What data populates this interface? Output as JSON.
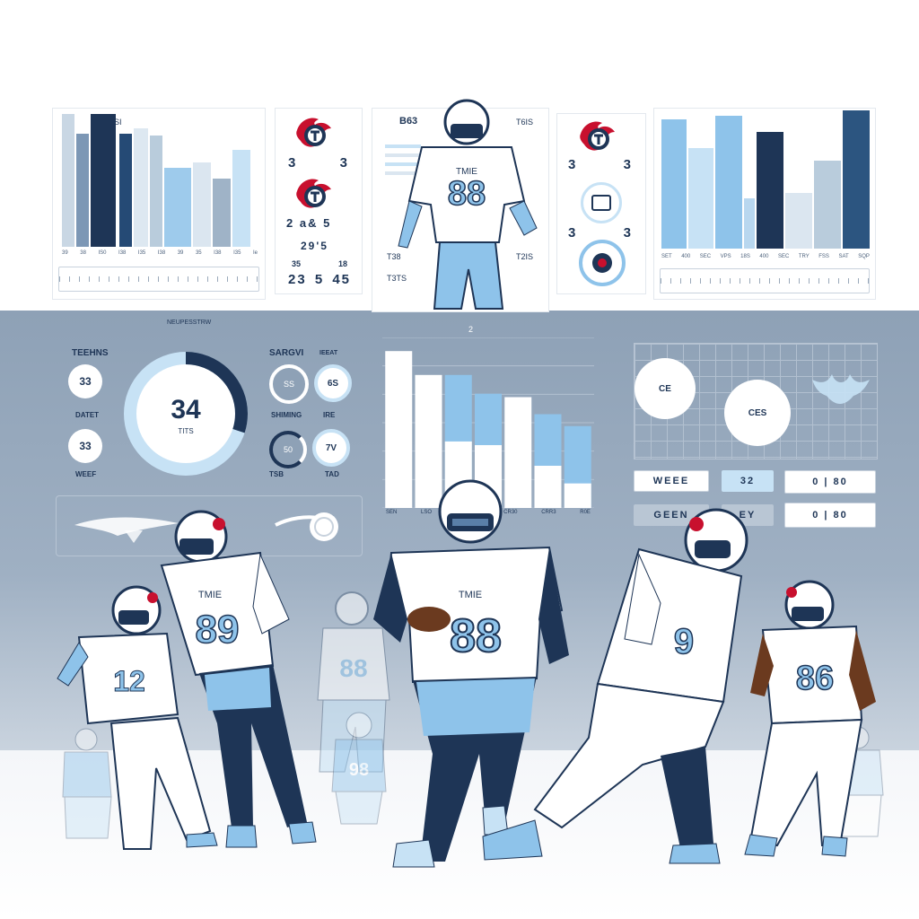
{
  "colors": {
    "navy": "#1e3556",
    "sky": "#8ec3ea",
    "light_sky": "#c7e2f5",
    "band": "#9fb0c3",
    "red": "#c8102e"
  },
  "icons": [
    "titans-logo-icon",
    "shield-icon",
    "football-icon",
    "wing-icon"
  ],
  "top_left_chart": {
    "label": "ETNSI",
    "ticks": [
      "39",
      "38",
      "IS0",
      "I38",
      "I35",
      "I38",
      "39",
      "35",
      "I38",
      "I35",
      "Ie"
    ]
  },
  "top_left_logos": {
    "score_row_1": [
      "3",
      "3"
    ],
    "score_row_2": "2 a& 5",
    "score_row_3": "29'5",
    "score_row_4": [
      "35",
      "18"
    ],
    "score_row_5": [
      "23",
      "5",
      "45"
    ]
  },
  "center_player": {
    "jersey_number": "88",
    "jersey_text": "TMIE",
    "labels": [
      "B63",
      "T6IS",
      "T2IS",
      "T38",
      "T3TS"
    ]
  },
  "top_right_logos": {
    "score_rows": [
      "3",
      "3",
      "3",
      "3"
    ]
  },
  "top_right_chart": {
    "ticks": [
      "SET",
      "400",
      "SEC",
      "VPS",
      "18S",
      "400",
      "SEC",
      "TRY",
      "FSS",
      "SAT",
      "SQP"
    ]
  },
  "middle": {
    "header": "NEUPESSTRW",
    "stats_left": {
      "label_1": "TEEHNS",
      "value_1": "33",
      "label_2": "DATET",
      "value_2": "33",
      "label_3": "WEEF"
    },
    "donut": {
      "value": "34",
      "label": "TITS",
      "fraction": 0.3
    },
    "mini_gauges": {
      "label_1": "SARGVI",
      "label_2": "IEEAT",
      "label_3": "SHIMING",
      "label_4": "IRE",
      "g1_text": "SS",
      "g2_text": "6S",
      "g3_text": "50",
      "g4_text": "7V",
      "foot_1": "TSB",
      "foot_2": "TAD"
    },
    "bar_chart": {
      "ticks": [
        "SEN",
        "LSO",
        "",
        "",
        "CR30",
        "CRR3",
        "R0E"
      ],
      "values": [
        0.92,
        0.78,
        0.78,
        0.67,
        0.65,
        0.55,
        0.48
      ],
      "split": [
        0,
        0,
        0.5,
        0.55,
        0,
        0.45,
        0.3
      ]
    },
    "right_grid": {
      "circle_1": "CE",
      "circle_2": "CES",
      "top_mark": "2"
    },
    "pills": {
      "p1": "WEEE",
      "p2": "32",
      "p3": "0 | 80",
      "p4": "GEEN",
      "p5": "EY",
      "p6": "0 | 80"
    }
  },
  "players": {
    "left_1": "12",
    "left_2": "89",
    "left_2_text": "TMIE",
    "center": "88",
    "center_text": "TMIE",
    "right_1": "9",
    "right_2": "86",
    "bg_1": "88",
    "bg_2": "98"
  }
}
